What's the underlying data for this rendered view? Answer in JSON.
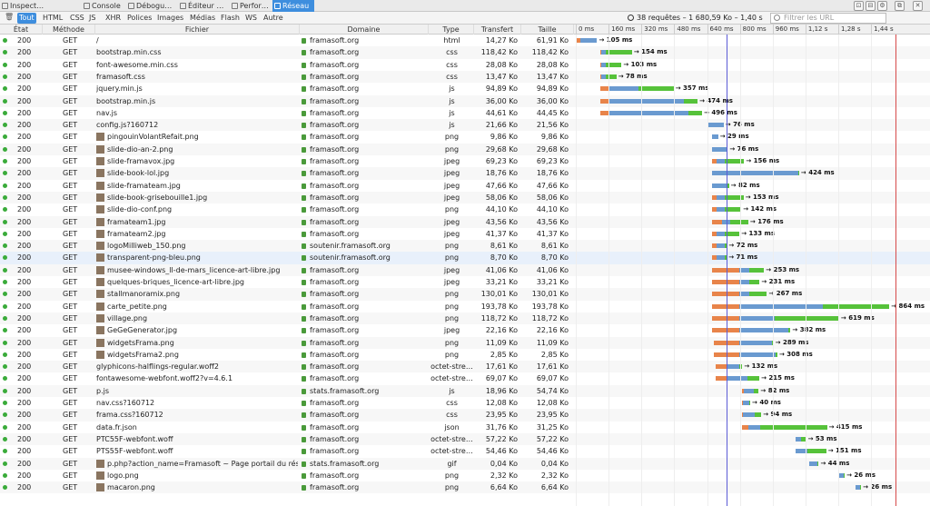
{
  "devtools": {
    "tabs": [
      {
        "label": "Inspect…",
        "selected": false
      },
      {
        "label": "Console",
        "selected": false
      },
      {
        "label": "Débogu…",
        "selected": false
      },
      {
        "label": "Éditeur …",
        "selected": false
      },
      {
        "label": "Perfor…",
        "selected": false
      },
      {
        "label": "Réseau",
        "selected": true
      }
    ],
    "toolbar_buttons": [
      "⊡",
      "⊟",
      "⚙",
      "⧉",
      "✕"
    ]
  },
  "filters": {
    "trash_icon": "🗑",
    "types": [
      {
        "label": "Tout",
        "selected": true
      },
      {
        "label": "HTML",
        "selected": false
      },
      {
        "label": "CSS",
        "selected": false
      },
      {
        "label": "JS",
        "selected": false
      },
      {
        "label": "XHR",
        "selected": false
      },
      {
        "label": "Polices",
        "selected": false
      },
      {
        "label": "Images",
        "selected": false
      },
      {
        "label": "Médias",
        "selected": false
      },
      {
        "label": "Flash",
        "selected": false
      },
      {
        "label": "WS",
        "selected": false
      },
      {
        "label": "Autre",
        "selected": false
      }
    ],
    "summary": "38 requêtes – 1 680,59 Ko – 1,40 s",
    "url_filter_placeholder": "Filtrer les URL"
  },
  "columns": {
    "status": "État",
    "method": "Méthode",
    "file": "Fichier",
    "domain": "Domaine",
    "type": "Type",
    "transfer": "Transfert",
    "size": "Taille"
  },
  "timeline_ticks": [
    "0 ms",
    "160 ms",
    "320 ms",
    "480 ms",
    "640 ms",
    "800 ms",
    "960 ms",
    "1,12 s",
    "1,28 s",
    "1,44 s"
  ],
  "colors": {
    "status_ok": "#3aab3a",
    "seg_orange": "#e8844a",
    "seg_blue": "#6a9ad0",
    "seg_green": "#56c23a",
    "selected_tab": "#3e8ede",
    "dom_line": "#5b5bd6",
    "load_line": "#d64a4a"
  },
  "requests": [
    {
      "status": "200",
      "method": "GET",
      "file": "/",
      "domain": "framasoft.org",
      "type": "html",
      "transfer": "14,27 Ko",
      "size": "61,91 Ko",
      "thumb": false,
      "start": 0,
      "orange": 22,
      "blue": 82,
      "green": 0,
      "label": "→ 105 ms"
    },
    {
      "status": "200",
      "method": "GET",
      "file": "bootstrap.min.css",
      "domain": "framasoft.org",
      "type": "css",
      "transfer": "118,42 Ko",
      "size": "118,42 Ko",
      "thumb": false,
      "start": 120,
      "orange": 6,
      "blue": 22,
      "green": 126,
      "label": "→ 154 ms"
    },
    {
      "status": "200",
      "method": "GET",
      "file": "font-awesome.min.css",
      "domain": "framasoft.org",
      "type": "css",
      "transfer": "28,08 Ko",
      "size": "28,08 Ko",
      "thumb": false,
      "start": 120,
      "orange": 6,
      "blue": 20,
      "green": 77,
      "label": "→ 103 ms"
    },
    {
      "status": "200",
      "method": "GET",
      "file": "framasoft.css",
      "domain": "framasoft.org",
      "type": "css",
      "transfer": "13,47 Ko",
      "size": "13,47 Ko",
      "thumb": false,
      "start": 120,
      "orange": 6,
      "blue": 20,
      "green": 52,
      "label": "→ 78 ms"
    },
    {
      "status": "200",
      "method": "GET",
      "file": "jquery.min.js",
      "domain": "framasoft.org",
      "type": "js",
      "transfer": "94,89 Ko",
      "size": "94,89 Ko",
      "thumb": false,
      "start": 120,
      "orange": 45,
      "blue": 140,
      "green": 172,
      "label": "→ 357 ms"
    },
    {
      "status": "200",
      "method": "GET",
      "file": "bootstrap.min.js",
      "domain": "framasoft.org",
      "type": "js",
      "transfer": "36,00 Ko",
      "size": "36,00 Ko",
      "thumb": false,
      "start": 120,
      "orange": 45,
      "blue": 360,
      "green": 69,
      "label": "→ 474 ms"
    },
    {
      "status": "200",
      "method": "GET",
      "file": "nav.js",
      "domain": "framasoft.org",
      "type": "js",
      "transfer": "44,61 Ko",
      "size": "44,45 Ko",
      "thumb": false,
      "start": 120,
      "orange": 45,
      "blue": 385,
      "green": 66,
      "label": "→ 496 ms"
    },
    {
      "status": "200",
      "method": "GET",
      "file": "config.js?160712",
      "domain": "framasoft.org",
      "type": "js",
      "transfer": "21,66 Ko",
      "size": "21,56 Ko",
      "thumb": false,
      "start": 645,
      "orange": 0,
      "blue": 76,
      "green": 0,
      "label": "→ 76 ms"
    },
    {
      "status": "200",
      "method": "GET",
      "file": "pingouinVolantRefait.png",
      "domain": "framasoft.org",
      "type": "png",
      "transfer": "9,86 Ko",
      "size": "9,86 Ko",
      "thumb": true,
      "start": 665,
      "orange": 0,
      "blue": 29,
      "green": 0,
      "label": "→ 29 ms"
    },
    {
      "status": "200",
      "method": "GET",
      "file": "slide-dio-an-2.png",
      "domain": "framasoft.org",
      "type": "png",
      "transfer": "29,68 Ko",
      "size": "29,68 Ko",
      "thumb": true,
      "start": 665,
      "orange": 0,
      "blue": 70,
      "green": 6,
      "label": "→ 76 ms"
    },
    {
      "status": "200",
      "method": "GET",
      "file": "slide-framavox.jpg",
      "domain": "framasoft.org",
      "type": "jpeg",
      "transfer": "69,23 Ko",
      "size": "69,23 Ko",
      "thumb": true,
      "start": 665,
      "orange": 22,
      "blue": 40,
      "green": 94,
      "label": "→ 156 ms"
    },
    {
      "status": "200",
      "method": "GET",
      "file": "slide-book-lol.jpg",
      "domain": "framasoft.org",
      "type": "jpeg",
      "transfer": "18,76 Ko",
      "size": "18,76 Ko",
      "thumb": true,
      "start": 665,
      "orange": 0,
      "blue": 418,
      "green": 6,
      "label": "→ 424 ms"
    },
    {
      "status": "200",
      "method": "GET",
      "file": "slide-framateam.jpg",
      "domain": "framasoft.org",
      "type": "jpeg",
      "transfer": "47,66 Ko",
      "size": "47,66 Ko",
      "thumb": true,
      "start": 665,
      "orange": 0,
      "blue": 75,
      "green": 7,
      "label": "→ 82 ms"
    },
    {
      "status": "200",
      "method": "GET",
      "file": "slide-book-grisebouille1.jpg",
      "domain": "framasoft.org",
      "type": "jpeg",
      "transfer": "58,06 Ko",
      "size": "58,06 Ko",
      "thumb": true,
      "start": 665,
      "orange": 22,
      "blue": 40,
      "green": 91,
      "label": "→ 153 ms"
    },
    {
      "status": "200",
      "method": "GET",
      "file": "slide-dio-conf.png",
      "domain": "framasoft.org",
      "type": "png",
      "transfer": "44,10 Ko",
      "size": "44,10 Ko",
      "thumb": true,
      "start": 665,
      "orange": 22,
      "blue": 40,
      "green": 80,
      "label": "→ 142 ms"
    },
    {
      "status": "200",
      "method": "GET",
      "file": "framateam1.jpg",
      "domain": "framasoft.org",
      "type": "jpeg",
      "transfer": "43,56 Ko",
      "size": "43,56 Ko",
      "thumb": true,
      "start": 665,
      "orange": 48,
      "blue": 40,
      "green": 88,
      "label": "→ 176 ms"
    },
    {
      "status": "200",
      "method": "GET",
      "file": "framateam2.jpg",
      "domain": "framasoft.org",
      "type": "jpeg",
      "transfer": "41,37 Ko",
      "size": "41,37 Ko",
      "thumb": true,
      "start": 665,
      "orange": 22,
      "blue": 40,
      "green": 71,
      "label": "→ 133 ms"
    },
    {
      "status": "200",
      "method": "GET",
      "file": "logoMilliweb_150.png",
      "domain": "soutenir.framasoft.org",
      "type": "png",
      "transfer": "8,61 Ko",
      "size": "8,61 Ko",
      "thumb": true,
      "start": 665,
      "orange": 22,
      "blue": 40,
      "green": 10,
      "label": "→ 72 ms"
    },
    {
      "status": "200",
      "method": "GET",
      "file": "transparent-png-bleu.png",
      "domain": "soutenir.framasoft.org",
      "type": "png",
      "transfer": "8,70 Ko",
      "size": "8,70 Ko",
      "thumb": true,
      "start": 665,
      "orange": 22,
      "blue": 40,
      "green": 9,
      "label": "→ 71 ms"
    },
    {
      "status": "200",
      "method": "GET",
      "file": "musee-windows_ll-de-mars_licence-art-libre.jpg",
      "domain": "framasoft.org",
      "type": "jpeg",
      "transfer": "41,06 Ko",
      "size": "41,06 Ko",
      "thumb": true,
      "start": 665,
      "orange": 130,
      "blue": 50,
      "green": 73,
      "label": "→ 253 ms"
    },
    {
      "status": "200",
      "method": "GET",
      "file": "quelques-briques_licence-art-libre.jpg",
      "domain": "framasoft.org",
      "type": "jpeg",
      "transfer": "33,21 Ko",
      "size": "33,21 Ko",
      "thumb": true,
      "start": 665,
      "orange": 130,
      "blue": 50,
      "green": 51,
      "label": "→ 231 ms"
    },
    {
      "status": "200",
      "method": "GET",
      "file": "stallmanoramix.png",
      "domain": "framasoft.org",
      "type": "png",
      "transfer": "130,01 Ko",
      "size": "130,01 Ko",
      "thumb": true,
      "start": 665,
      "orange": 130,
      "blue": 50,
      "green": 87,
      "label": "→ 267 ms"
    },
    {
      "status": "200",
      "method": "GET",
      "file": "carte_petite.png",
      "domain": "framasoft.org",
      "type": "png",
      "transfer": "193,78 Ko",
      "size": "193,78 Ko",
      "thumb": true,
      "start": 665,
      "orange": 130,
      "blue": 410,
      "green": 324,
      "label": "→ 864 ms"
    },
    {
      "status": "200",
      "method": "GET",
      "file": "village.png",
      "domain": "framasoft.org",
      "type": "png",
      "transfer": "118,72 Ko",
      "size": "118,72 Ko",
      "thumb": true,
      "start": 665,
      "orange": 130,
      "blue": 175,
      "green": 314,
      "label": "→ 619 ms"
    },
    {
      "status": "200",
      "method": "GET",
      "file": "GeGeGenerator.jpg",
      "domain": "framasoft.org",
      "type": "jpeg",
      "transfer": "22,16 Ko",
      "size": "22,16 Ko",
      "thumb": true,
      "start": 665,
      "orange": 130,
      "blue": 240,
      "green": 12,
      "label": "→ 382 ms"
    },
    {
      "status": "200",
      "method": "GET",
      "file": "widgetsFrama.png",
      "domain": "framasoft.org",
      "type": "png",
      "transfer": "11,09 Ko",
      "size": "11,09 Ko",
      "thumb": true,
      "start": 675,
      "orange": 120,
      "blue": 160,
      "green": 9,
      "label": "→ 289 ms"
    },
    {
      "status": "200",
      "method": "GET",
      "file": "widgetsFrama2.png",
      "domain": "framasoft.org",
      "type": "png",
      "transfer": "2,85 Ko",
      "size": "2,85 Ko",
      "thumb": true,
      "start": 675,
      "orange": 120,
      "blue": 180,
      "green": 8,
      "label": "→ 308 ms"
    },
    {
      "status": "200",
      "method": "GET",
      "file": "glyphicons-halflings-regular.woff2",
      "domain": "framasoft.org",
      "type": "octet-stre…",
      "transfer": "17,61 Ko",
      "size": "17,61 Ko",
      "thumb": false,
      "start": 680,
      "orange": 55,
      "blue": 60,
      "green": 17,
      "label": "→ 132 ms"
    },
    {
      "status": "200",
      "method": "GET",
      "file": "fontawesome-webfont.woff2?v=4.6.1",
      "domain": "framasoft.org",
      "type": "octet-stre…",
      "transfer": "69,07 Ko",
      "size": "69,07 Ko",
      "thumb": false,
      "start": 680,
      "orange": 55,
      "blue": 100,
      "green": 60,
      "label": "→ 215 ms"
    },
    {
      "status": "200",
      "method": "GET",
      "file": "p.js",
      "domain": "stats.framasoft.org",
      "type": "js",
      "transfer": "18,96 Ko",
      "size": "54,74 Ko",
      "thumb": false,
      "start": 810,
      "orange": 10,
      "blue": 50,
      "green": 22,
      "label": "→ 82 ms"
    },
    {
      "status": "200",
      "method": "GET",
      "file": "nav.css?160712",
      "domain": "framasoft.org",
      "type": "css",
      "transfer": "12,08 Ko",
      "size": "12,08 Ko",
      "thumb": false,
      "start": 810,
      "orange": 4,
      "blue": 30,
      "green": 6,
      "label": "→ 40 ms"
    },
    {
      "status": "200",
      "method": "GET",
      "file": "frama.css?160712",
      "domain": "framasoft.org",
      "type": "css",
      "transfer": "23,95 Ko",
      "size": "23,95 Ko",
      "thumb": false,
      "start": 810,
      "orange": 4,
      "blue": 60,
      "green": 30,
      "label": "→ 94 ms"
    },
    {
      "status": "200",
      "method": "GET",
      "file": "data.fr.json",
      "domain": "framasoft.org",
      "type": "json",
      "transfer": "31,76 Ko",
      "size": "31,25 Ko",
      "thumb": false,
      "start": 810,
      "orange": 30,
      "blue": 60,
      "green": 325,
      "label": "→ 415 ms"
    },
    {
      "status": "200",
      "method": "GET",
      "file": "PTC55F-webfont.woff",
      "domain": "framasoft.org",
      "type": "octet-stre…",
      "transfer": "57,22 Ko",
      "size": "57,22 Ko",
      "thumb": false,
      "start": 1070,
      "orange": 0,
      "blue": 30,
      "green": 23,
      "label": "→ 53 ms"
    },
    {
      "status": "200",
      "method": "GET",
      "file": "PTS55F-webfont.woff",
      "domain": "framasoft.org",
      "type": "octet-stre…",
      "transfer": "54,46 Ko",
      "size": "54,46 Ko",
      "thumb": false,
      "start": 1070,
      "orange": 0,
      "blue": 60,
      "green": 91,
      "label": "→ 151 ms"
    },
    {
      "status": "200",
      "method": "GET",
      "file": "p.php?action_name=Framasoft ~ Page portail du rése…",
      "domain": "stats.framasoft.org",
      "type": "gif",
      "transfer": "0,04 Ko",
      "size": "0,04 Ko",
      "thumb": true,
      "start": 1140,
      "orange": 0,
      "blue": 40,
      "green": 4,
      "label": "→ 44 ms"
    },
    {
      "status": "200",
      "method": "GET",
      "file": "logo.png",
      "domain": "framasoft.org",
      "type": "png",
      "transfer": "2,32 Ko",
      "size": "2,32 Ko",
      "thumb": true,
      "start": 1285,
      "orange": 0,
      "blue": 22,
      "green": 4,
      "label": "→ 26 ms"
    },
    {
      "status": "200",
      "method": "GET",
      "file": "macaron.png",
      "domain": "framasoft.org",
      "type": "png",
      "transfer": "6,64 Ko",
      "size": "6,64 Ko",
      "thumb": true,
      "start": 1365,
      "orange": 0,
      "blue": 22,
      "green": 4,
      "label": "→ 26 ms"
    }
  ],
  "markers": {
    "dom_content_loaded_ms": 735,
    "load_ms": 1560
  }
}
